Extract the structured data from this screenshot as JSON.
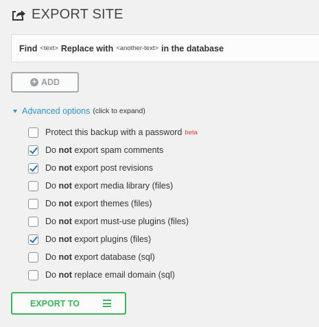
{
  "header": {
    "icon": "export-icon",
    "title": "EXPORT SITE"
  },
  "replace": {
    "find_label": "Find",
    "find_placeholder": "<text>",
    "replace_label": "Replace with",
    "replace_placeholder": "<another-text>",
    "suffix": "in the database"
  },
  "add_button": {
    "icon": "plus-circle-icon",
    "label": "ADD"
  },
  "advanced": {
    "icon": "caret-down-icon",
    "label": "Advanced options",
    "hint": "(click to expand)"
  },
  "options": [
    {
      "prefix": "Protect this backup with a password",
      "bold": "",
      "suffix": "",
      "badge": "beta",
      "checked": false
    },
    {
      "prefix": "Do ",
      "bold": "not",
      "suffix": " export spam comments",
      "badge": "",
      "checked": true
    },
    {
      "prefix": "Do ",
      "bold": "not",
      "suffix": " export post revisions",
      "badge": "",
      "checked": true
    },
    {
      "prefix": "Do ",
      "bold": "not",
      "suffix": " export media library (files)",
      "badge": "",
      "checked": false
    },
    {
      "prefix": "Do ",
      "bold": "not",
      "suffix": " export themes (files)",
      "badge": "",
      "checked": false
    },
    {
      "prefix": "Do ",
      "bold": "not",
      "suffix": " export must-use plugins (files)",
      "badge": "",
      "checked": false
    },
    {
      "prefix": "Do ",
      "bold": "not",
      "suffix": " export plugins (files)",
      "badge": "",
      "checked": true
    },
    {
      "prefix": "Do ",
      "bold": "not",
      "suffix": " export database (sql)",
      "badge": "",
      "checked": false
    },
    {
      "prefix": "Do ",
      "bold": "not",
      "suffix": " replace email domain (sql)",
      "badge": "",
      "checked": false
    }
  ],
  "export_to": {
    "label": "EXPORT TO",
    "icon": "menu-icon"
  },
  "colors": {
    "accent_blue": "#2f91c4",
    "checkmark_blue": "#2271b1",
    "green": "#3fb05c",
    "beta_red": "#d63638"
  }
}
